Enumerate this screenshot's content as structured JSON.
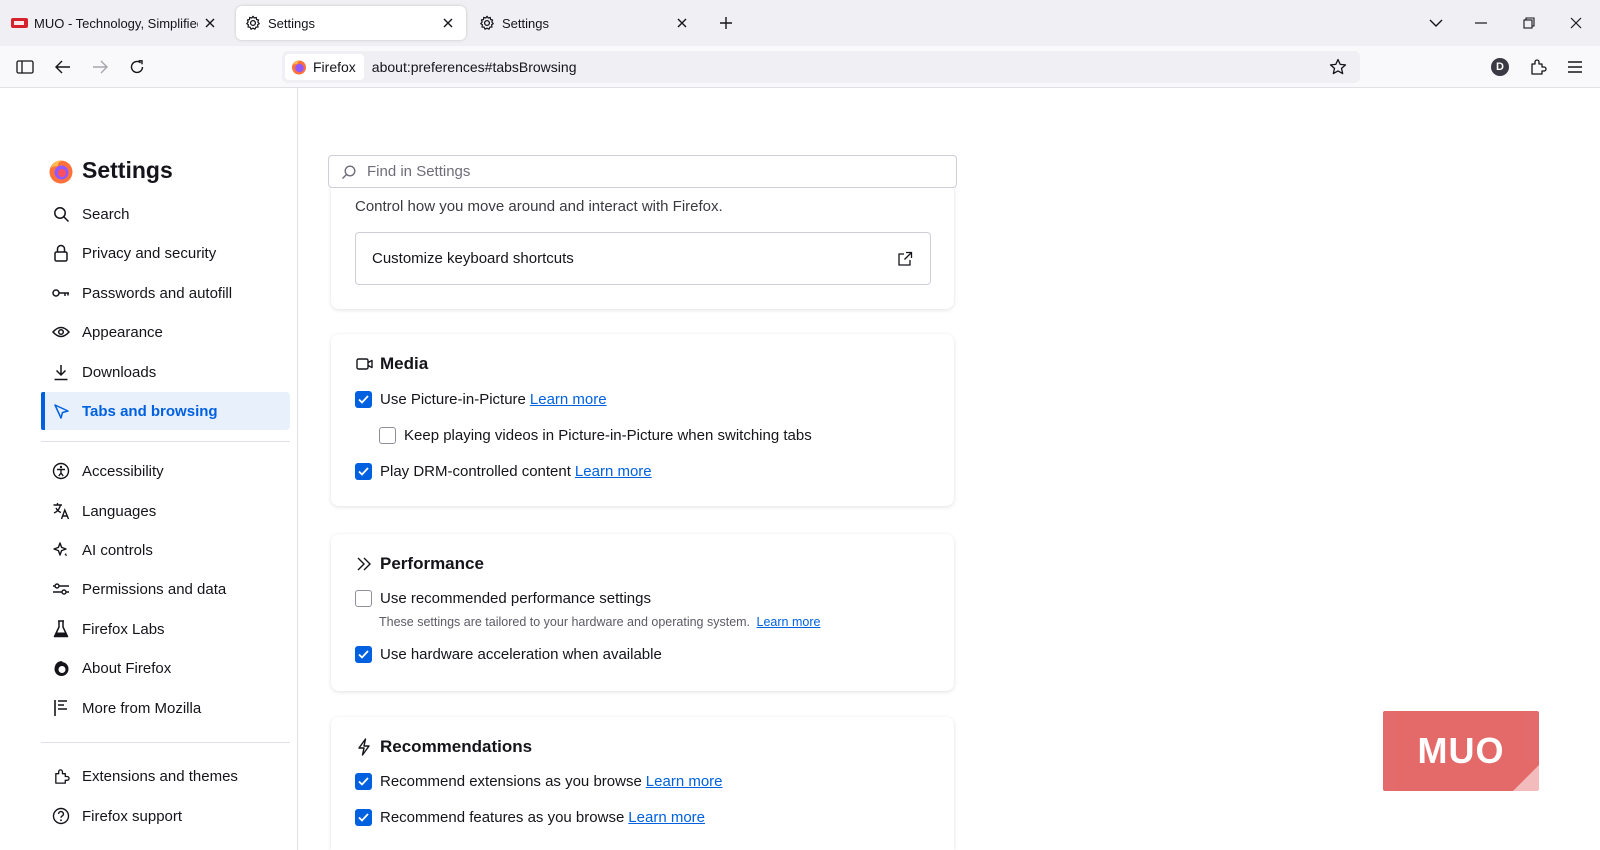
{
  "tabs": [
    {
      "title": "MUO - Technology, Simplified.",
      "icon": "muo-favicon",
      "active": false
    },
    {
      "title": "Settings",
      "icon": "gear-icon",
      "active": true
    },
    {
      "title": "Settings",
      "icon": "gear-icon",
      "active": false
    }
  ],
  "navbar": {
    "identity_label": "Firefox",
    "url": "about:preferences#tabsBrowsing",
    "account_initial": "D"
  },
  "sidebar": {
    "title": "Settings",
    "items": [
      {
        "label": "Search",
        "icon": "search-icon"
      },
      {
        "label": "Privacy and security",
        "icon": "lock-icon"
      },
      {
        "label": "Passwords and autofill",
        "icon": "key-icon"
      },
      {
        "label": "Appearance",
        "icon": "eye-icon"
      },
      {
        "label": "Downloads",
        "icon": "download-icon"
      },
      {
        "label": "Tabs and browsing",
        "icon": "cursor-icon",
        "selected": true
      },
      {
        "label": "Accessibility",
        "icon": "accessibility-icon"
      },
      {
        "label": "Languages",
        "icon": "translate-icon"
      },
      {
        "label": "AI controls",
        "icon": "sparkle-icon"
      },
      {
        "label": "Permissions and data",
        "icon": "sliders-icon"
      },
      {
        "label": "Firefox Labs",
        "icon": "flask-icon"
      },
      {
        "label": "About Firefox",
        "icon": "firefox-icon"
      },
      {
        "label": "More from Mozilla",
        "icon": "flag-icon"
      }
    ],
    "footer_items": [
      {
        "label": "Extensions and themes",
        "icon": "puzzle-icon"
      },
      {
        "label": "Firefox support",
        "icon": "help-icon"
      }
    ]
  },
  "search": {
    "placeholder": "Find in Settings"
  },
  "browsing": {
    "description": "Control how you move around and interact with Firefox.",
    "shortcut_button": "Customize keyboard shortcuts"
  },
  "media": {
    "heading": "Media",
    "pip_label": "Use Picture-in-Picture",
    "pip_link": "Learn more",
    "pip_checked": true,
    "keep_playing_label": "Keep playing videos in Picture-in-Picture when switching tabs",
    "keep_playing_checked": false,
    "drm_label": "Play DRM-controlled content",
    "drm_link": "Learn more",
    "drm_checked": true
  },
  "performance": {
    "heading": "Performance",
    "recommended_label": "Use recommended performance settings",
    "recommended_checked": false,
    "recommended_hint": "These settings are tailored to your hardware and operating system.",
    "recommended_link": "Learn more",
    "hw_accel_label": "Use hardware acceleration when available",
    "hw_accel_checked": true
  },
  "recommendations": {
    "heading": "Recommendations",
    "extensions_label": "Recommend extensions as you browse",
    "extensions_link": "Learn more",
    "extensions_checked": true,
    "features_label": "Recommend features as you browse",
    "features_link": "Learn more",
    "features_checked": true
  },
  "watermark": {
    "text": "MUO"
  },
  "colors": {
    "accent": "#0061e0",
    "watermark": "#e25e5e"
  }
}
